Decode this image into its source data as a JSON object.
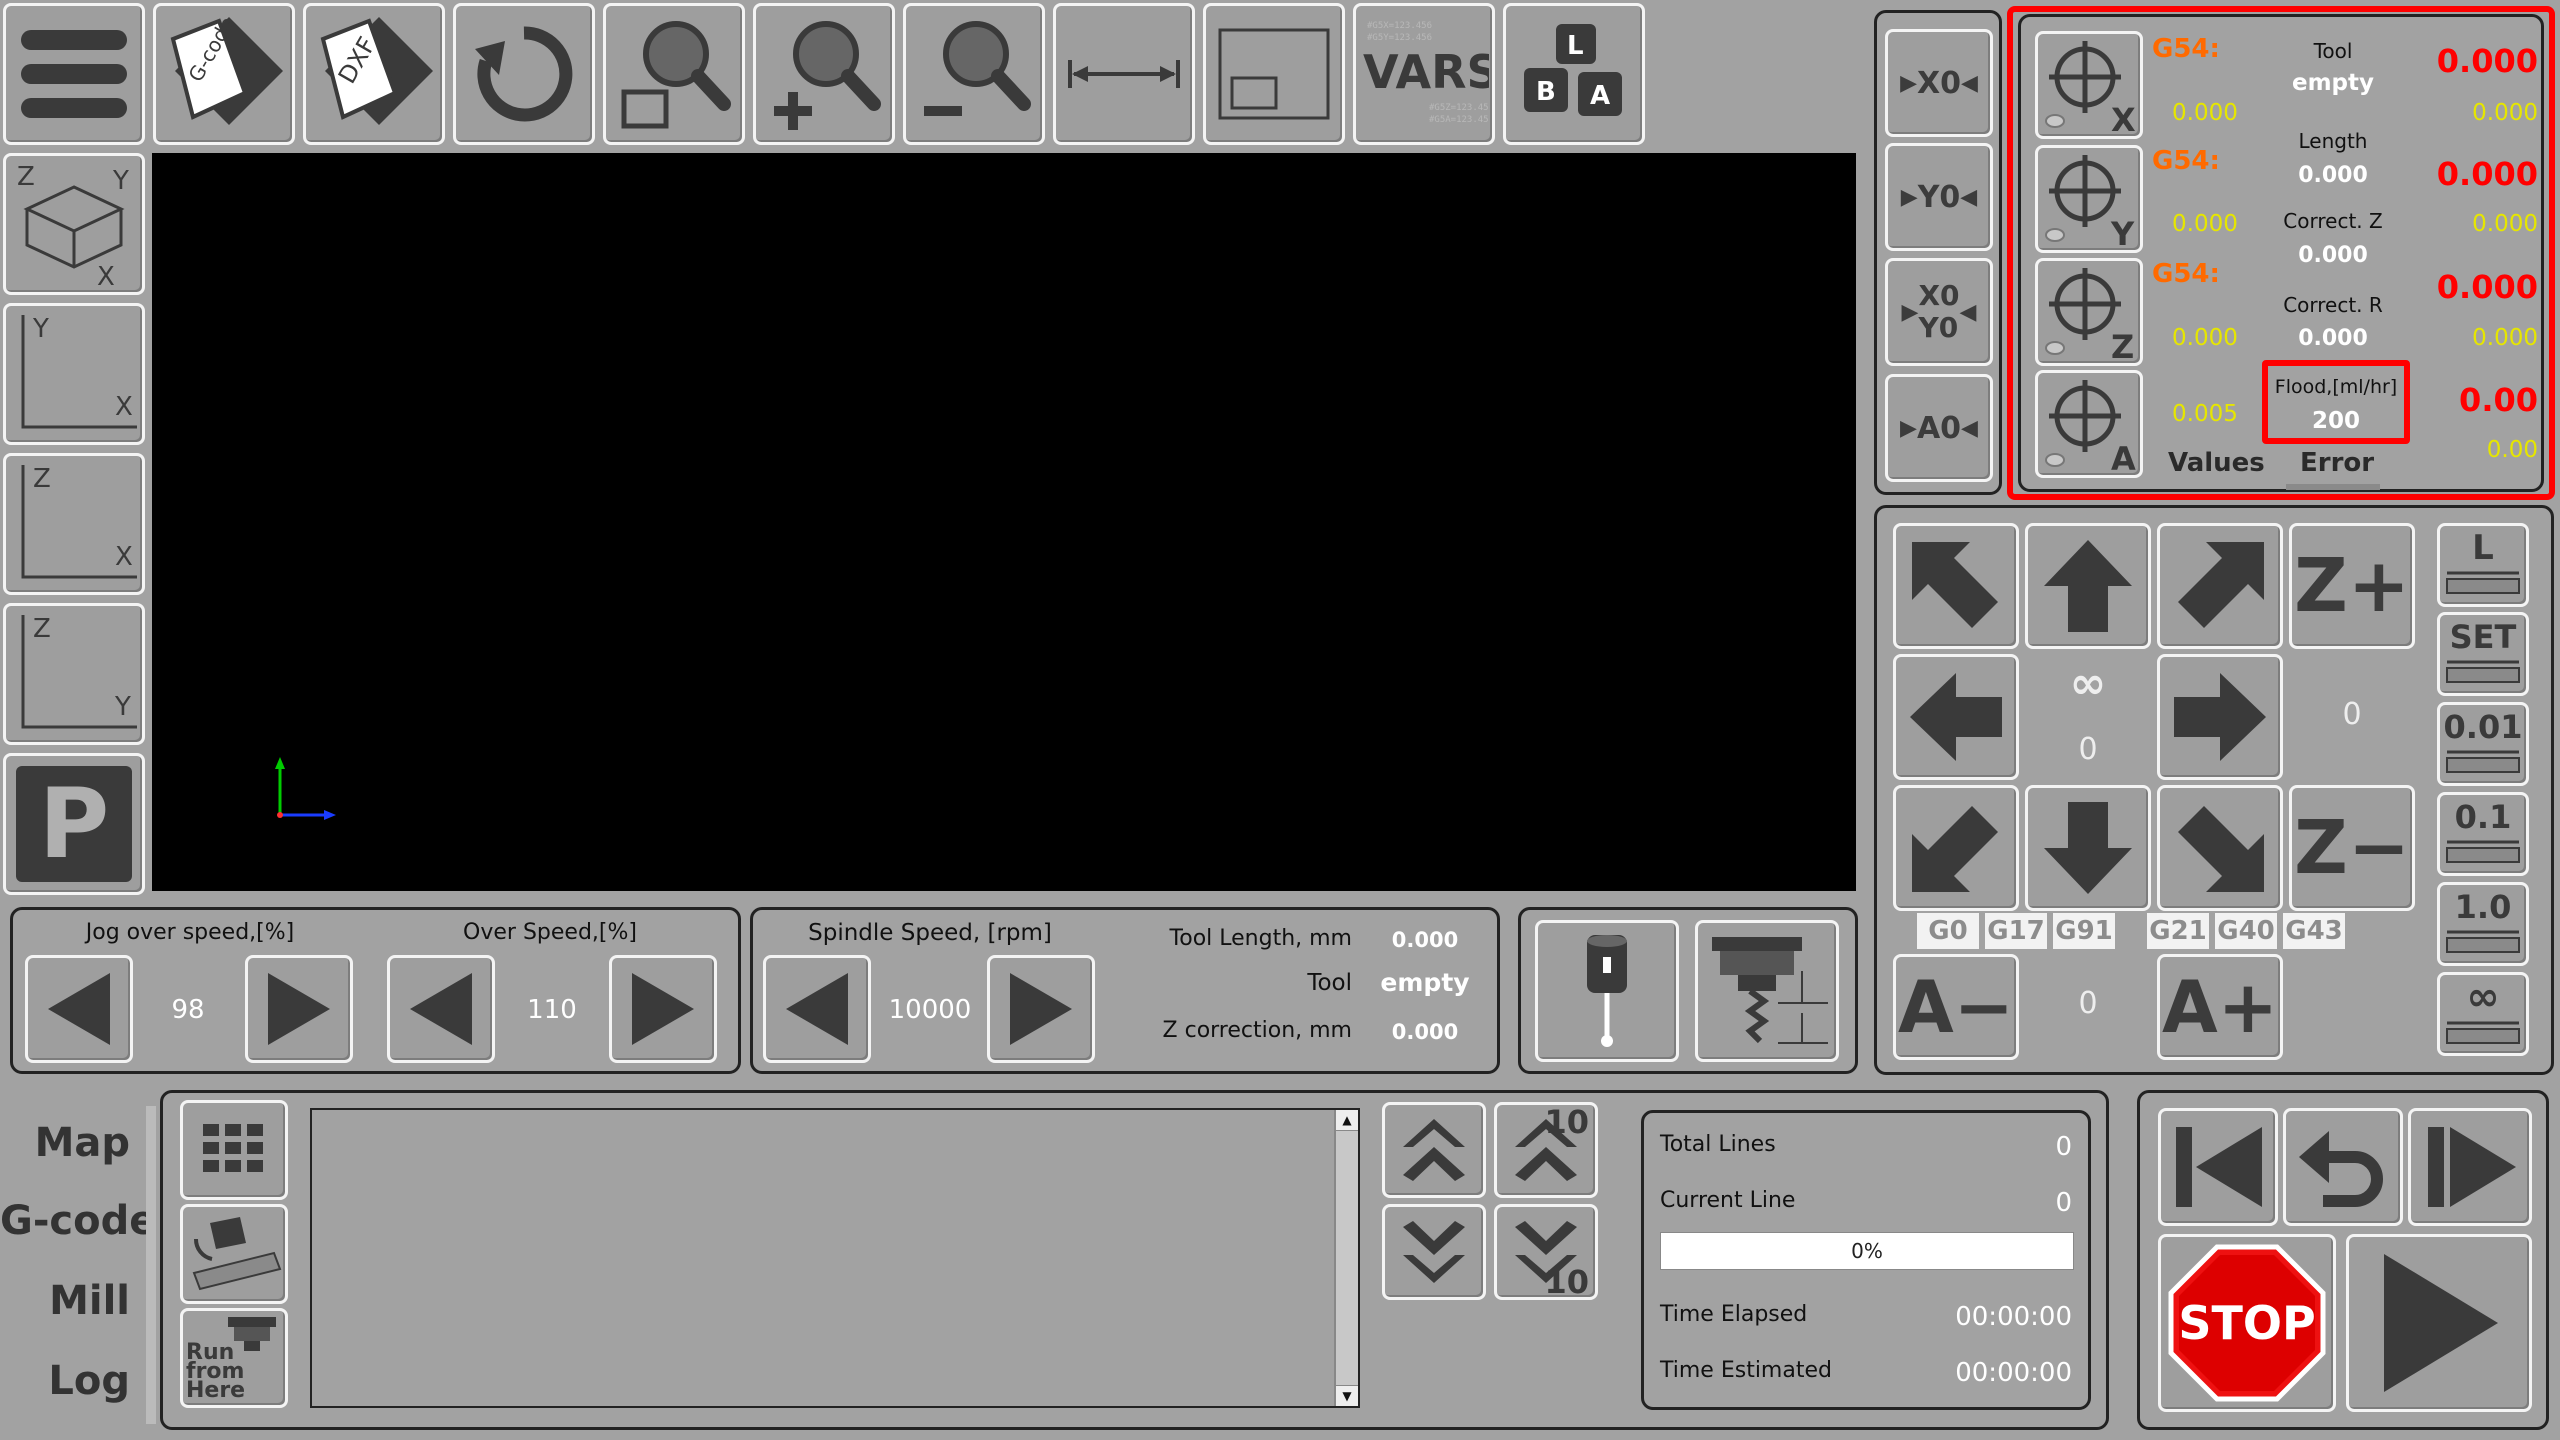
{
  "toolbar": {
    "gcode_label": "G-code",
    "dxf_label": "DXF",
    "vars_label": "VARS",
    "keys_labels": [
      "L",
      "B",
      "A"
    ]
  },
  "view_buttons": {
    "iso": {
      "a": "Z",
      "b": "Y",
      "c": "X"
    },
    "xy": {
      "v": "Y",
      "h": "X"
    },
    "zx": {
      "v": "Z",
      "h": "X"
    },
    "zy": {
      "v": "Z",
      "h": "Y"
    },
    "park": "P"
  },
  "zero_buttons": {
    "x0": "X0",
    "y0": "Y0",
    "x0y0_top": "X0",
    "x0y0_bottom": "Y0",
    "a0": "A0"
  },
  "dro": {
    "rows": [
      {
        "axis": "X",
        "wcs": "G54:",
        "offset": "0.000",
        "value": "0.000",
        "machine": "0.000",
        "info_label": "Tool",
        "info_value": "empty"
      },
      {
        "axis": "Y",
        "wcs": "G54:",
        "offset": "0.000",
        "value": "0.000",
        "machine": "0.000",
        "info_label": "Length",
        "info_value": "0.000"
      },
      {
        "axis": "Z",
        "wcs": "G54:",
        "offset": "0.000",
        "value": "0.000",
        "machine": "0.000",
        "info_label": "Correct. Z",
        "info_value": "0.000"
      },
      {
        "axis": "A",
        "wcs": "",
        "offset": "0.005",
        "value": "0.00",
        "machine": "0.00",
        "info_label": "Correct. R",
        "info_value": "0.000"
      }
    ],
    "flood_label": "Flood,[ml/hr]",
    "flood_value": "200",
    "tab_values": "Values",
    "tab_error": "Error"
  },
  "jog": {
    "infinity": "∞",
    "center_value": "0",
    "z_plus": "Z+",
    "z_minus": "Z−",
    "z_step_value": "0",
    "a_minus": "A−",
    "a_plus": "A+",
    "a_value": "0",
    "gcodes": [
      "G0",
      "G17",
      "G91",
      "G21",
      "G40",
      "G43"
    ],
    "steps": [
      "L",
      "SET",
      "0.01",
      "0.1",
      "1.0",
      "∞"
    ]
  },
  "speeds": {
    "jog_over_label": "Jog over speed,[%]",
    "jog_over_value": "98",
    "over_speed_label": "Over Speed,[%]",
    "over_speed_value": "110",
    "spindle_label": "Spindle Speed, [rpm]",
    "spindle_value": "10000",
    "tool_length_label": "Tool Length, mm",
    "tool_length_value": "0.000",
    "tool_label": "Tool",
    "tool_value": "empty",
    "zcorr_label": "Z correction, mm",
    "zcorr_value": "0.000"
  },
  "side_tabs": [
    "Map",
    "G-code",
    "Mill",
    "Log"
  ],
  "program_tools": {
    "run_from_here": [
      "Run",
      "from",
      "Here"
    ]
  },
  "scroll_steps": {
    "step10": "10"
  },
  "status": {
    "total_lines_label": "Total Lines",
    "total_lines": "0",
    "current_line_label": "Current Line",
    "current_line": "0",
    "progress": "0%",
    "progress_fraction": 0,
    "time_elapsed_label": "Time Elapsed",
    "time_elapsed": "00:00:00",
    "time_estimated_label": "Time Estimated",
    "time_estimated": "00:00:00"
  },
  "run_controls": {
    "stop_label": "STOP"
  },
  "colors": {
    "accent_red": "#ff0000",
    "offset_yellow": "#e6e600",
    "wcs_orange": "#ff6a00",
    "background": "#a2a2a2"
  }
}
